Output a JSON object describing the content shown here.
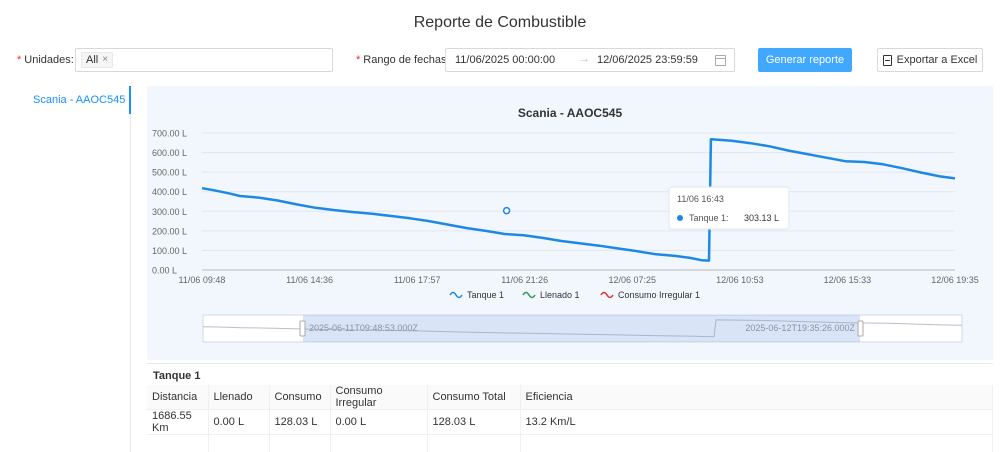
{
  "page": {
    "title": "Reporte de Combustible"
  },
  "filters": {
    "units_required_mark": "*",
    "units_label": "Unidades",
    "units_colon": ":",
    "units_tag": "All",
    "units_tag_close": "×",
    "range_required_mark": "*",
    "range_label": "Rango de fechas",
    "range_colon": ":",
    "range_start": "11/06/2025 00:00:00",
    "range_arrow": "→",
    "range_end": "12/06/2025 23:59:59",
    "generate_button": "Generar reporte",
    "export_button": "Exportar a Excel"
  },
  "sidebar": {
    "items": [
      {
        "label": "Scania - AAOC545",
        "active": true
      }
    ]
  },
  "chart_data": {
    "type": "line",
    "title": "Scania - AAOC545",
    "xlabel": "",
    "ylabel": "",
    "y_unit": "L",
    "ylim": [
      0,
      700
    ],
    "y_ticks": [
      "0.00 L",
      "100.00 L",
      "200.00 L",
      "300.00 L",
      "400.00 L",
      "500.00 L",
      "600.00 L",
      "700.00 L"
    ],
    "x_ticks": [
      "11/06 09:48",
      "11/06 14:36",
      "11/06 17:57",
      "11/06 21:26",
      "12/06 07:25",
      "12/06 10:53",
      "12/06 15:33",
      "12/06 19:35"
    ],
    "grid": true,
    "legend_position": "bottom",
    "series": [
      {
        "name": "Tanque 1",
        "color": "#1e88e5",
        "points": [
          [
            0,
            418
          ],
          [
            0.25,
            410
          ],
          [
            0.5,
            400
          ],
          [
            0.75,
            390
          ],
          [
            1,
            378
          ],
          [
            1.5,
            370
          ],
          [
            2,
            355
          ],
          [
            2.5,
            335
          ],
          [
            3,
            318
          ],
          [
            3.5,
            306
          ],
          [
            4,
            296
          ],
          [
            4.5,
            287
          ],
          [
            5,
            276
          ],
          [
            5.5,
            264
          ],
          [
            6,
            250
          ],
          [
            6.5,
            232
          ],
          [
            7,
            214
          ],
          [
            7.5,
            200
          ],
          [
            8,
            184
          ],
          [
            8.5,
            178
          ],
          [
            9,
            164
          ],
          [
            9.5,
            148
          ],
          [
            10,
            136
          ],
          [
            10.5,
            124
          ],
          [
            11,
            110
          ],
          [
            11.5,
            96
          ],
          [
            12,
            80
          ],
          [
            12.5,
            72
          ],
          [
            12.9,
            62
          ],
          [
            13.2,
            50
          ],
          [
            13.4,
            48
          ],
          [
            13.45,
            668
          ],
          [
            14,
            660
          ],
          [
            14.5,
            648
          ],
          [
            15,
            632
          ],
          [
            15.5,
            610
          ],
          [
            16,
            592
          ],
          [
            16.5,
            574
          ],
          [
            17,
            556
          ],
          [
            17.5,
            552
          ],
          [
            18,
            540
          ],
          [
            18.5,
            520
          ],
          [
            19,
            498
          ],
          [
            19.5,
            478
          ],
          [
            19.9,
            468
          ]
        ]
      },
      {
        "name": "Llenado 1",
        "color": "#2e9c4c",
        "points": []
      },
      {
        "name": "Consumo Irregular 1",
        "color": "#d4343c",
        "points": []
      }
    ],
    "tooltip": {
      "title": "11/06 16:43",
      "series": "Tanque 1:",
      "value": "303.13 L"
    },
    "zoom": {
      "start_label": "2025-06-11T09:48:53.000Z",
      "end_label": "2025-06-12T19:35:26.000Z"
    }
  },
  "summary": {
    "title": "Tanque 1",
    "headers": [
      "Distancia",
      "Llenado",
      "Consumo",
      "Consumo Irregular",
      "Consumo Total",
      "Eficiencia"
    ],
    "rows": [
      [
        "1686.55 Km",
        "0.00 L",
        "128.03 L",
        "0.00 L",
        "128.03 L",
        "13.2 Km/L"
      ]
    ]
  }
}
